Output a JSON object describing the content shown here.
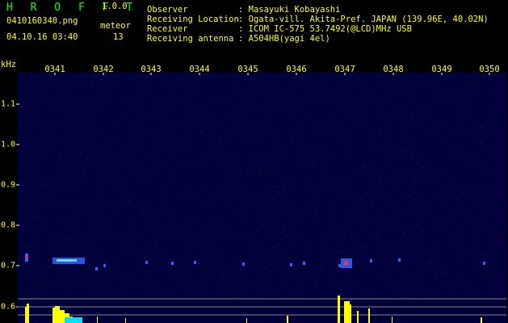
{
  "header": {
    "app_title": "H R O F F T",
    "version": "1.0.0",
    "filename": "0410160340.png",
    "datetime": "04.10.16 03:40",
    "meteor_label": "meteor",
    "meteor_count": "13"
  },
  "station": {
    "observer_label": "Observer",
    "observer_value": ": Masayuki Kobayashi",
    "location_label": "Receiving Location",
    "location_value": ": Ogata-vill. Akita-Pref. JAPAN (139.96E, 40.02N)",
    "receiver_label": "Receiver",
    "receiver_value": ": ICOM IC-575 53.7492(@LCD)MHz USB",
    "antenna_label": "Receiving antenna",
    "antenna_value": ": A504HB(yagi 4el)"
  },
  "time_axis": {
    "labels": [
      "0341",
      "0342",
      "0343",
      "0344",
      "0345",
      "0346",
      "0347",
      "0348",
      "0349",
      "0350"
    ]
  },
  "freq_axis": {
    "unit": "kHz",
    "labels": [
      "1.1",
      "1.0",
      "0.9",
      "0.8",
      "0.7",
      "0.6"
    ]
  },
  "colors": {
    "label": "#ffff00",
    "title": "#00ff00",
    "plot_bg": "#00003a",
    "grid": "#ffffff",
    "echo_core": "#ff3030",
    "echo_halo": "#3060ff",
    "level": "#ffff00",
    "level_secondary": "#00e0ff"
  }
}
